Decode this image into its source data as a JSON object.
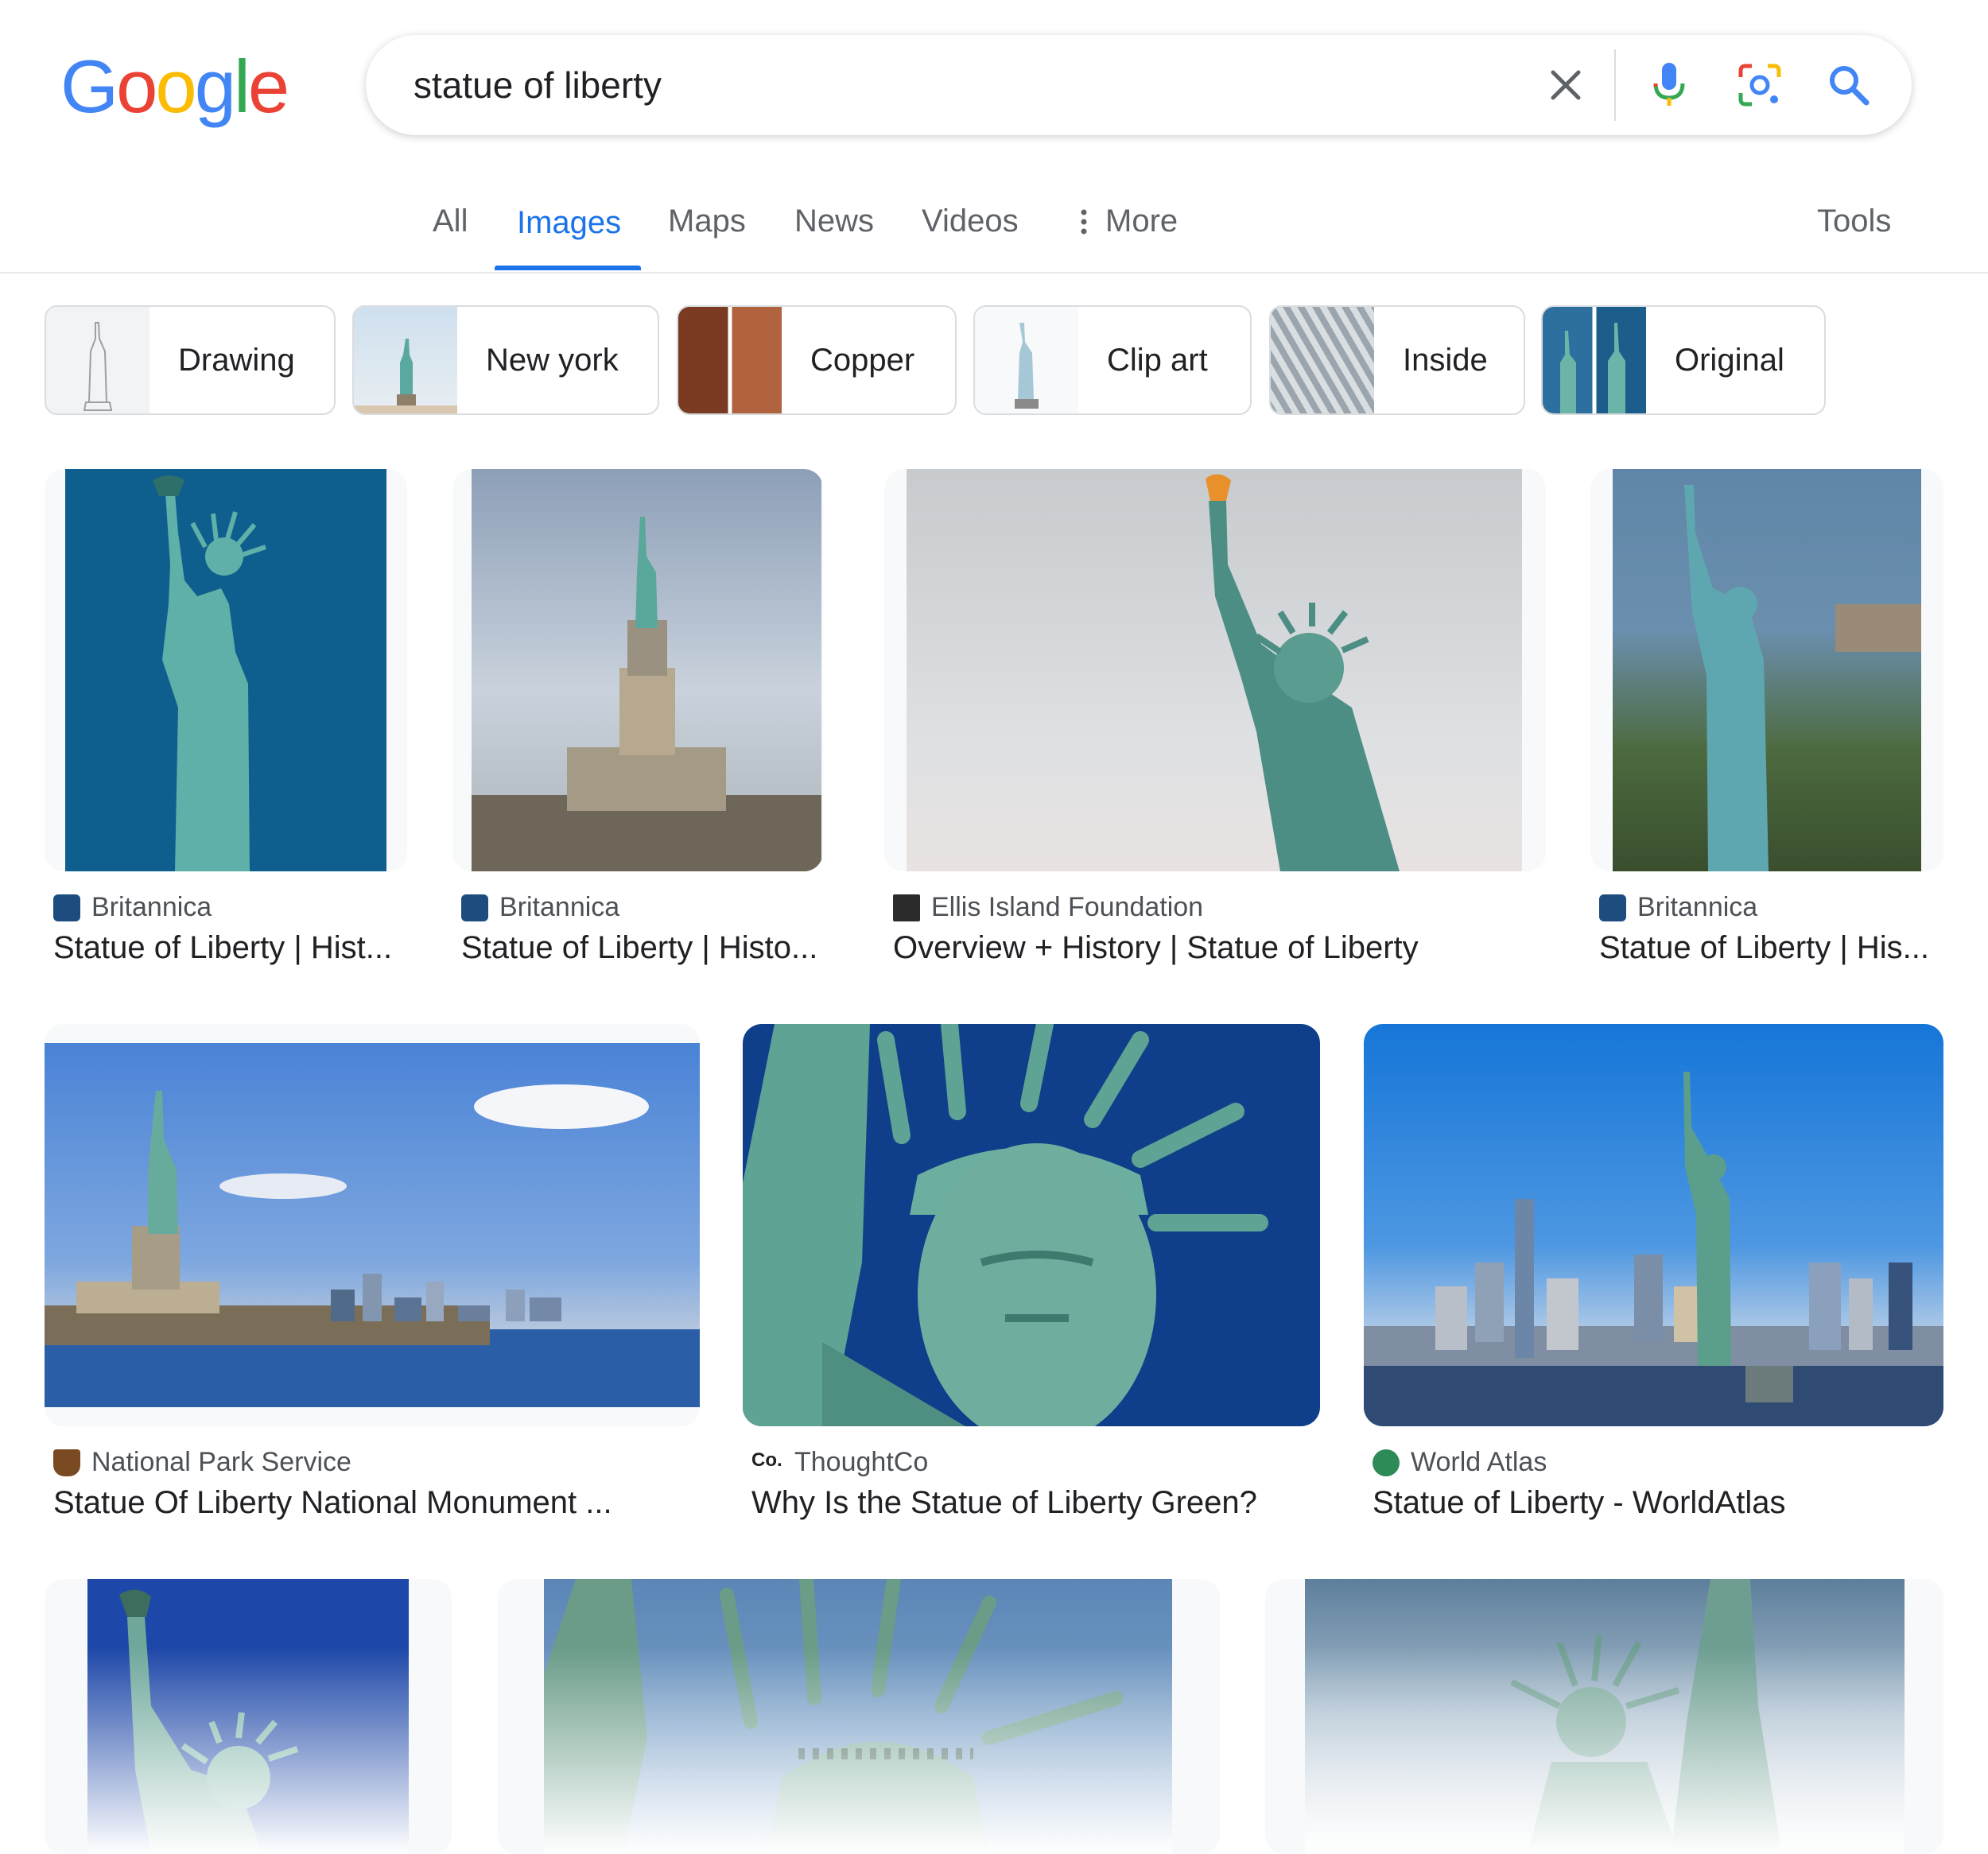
{
  "logo": {
    "text": "Google",
    "letters": [
      "G",
      "o",
      "o",
      "g",
      "l",
      "e"
    ],
    "colors": [
      "#4285F4",
      "#EA4335",
      "#FBBC05",
      "#4285F4",
      "#34A853",
      "#EA4335"
    ]
  },
  "search": {
    "query": "statue of liberty"
  },
  "icons": {
    "clear": "close-icon",
    "voice": "microphone-icon",
    "lens": "camera-lens-icon",
    "search": "search-icon",
    "more": "vertical-dots-icon"
  },
  "tabs": [
    {
      "label": "All"
    },
    {
      "label": "Images",
      "active": true
    },
    {
      "label": "Maps"
    },
    {
      "label": "News"
    },
    {
      "label": "Videos"
    },
    {
      "label": "More"
    }
  ],
  "tools_label": "Tools",
  "chips": [
    {
      "label": "Drawing"
    },
    {
      "label": "New york"
    },
    {
      "label": "Copper"
    },
    {
      "label": "Clip art"
    },
    {
      "label": "Inside"
    },
    {
      "label": "Original"
    }
  ],
  "results": [
    {
      "source": "Britannica",
      "title": "Statue of Liberty | Hist..."
    },
    {
      "source": "Britannica",
      "title": "Statue of Liberty | Histo..."
    },
    {
      "source": "Ellis Island Foundation",
      "title": "Overview + History | Statue of Liberty"
    },
    {
      "source": "Britannica",
      "title": "Statue of Liberty | His..."
    },
    {
      "source": "National Park Service",
      "title": "Statue Of Liberty National Monument ..."
    },
    {
      "source": "ThoughtCo",
      "title": "Why Is the Statue of Liberty Green?"
    },
    {
      "source": "World Atlas",
      "title": "Statue of Liberty - WorldAtlas"
    }
  ],
  "colors": {
    "accent": "#1a73e8",
    "statue": "#5aa8a0",
    "sky_deep": "#0d5f8f",
    "sky_light": "#5b93d9"
  }
}
